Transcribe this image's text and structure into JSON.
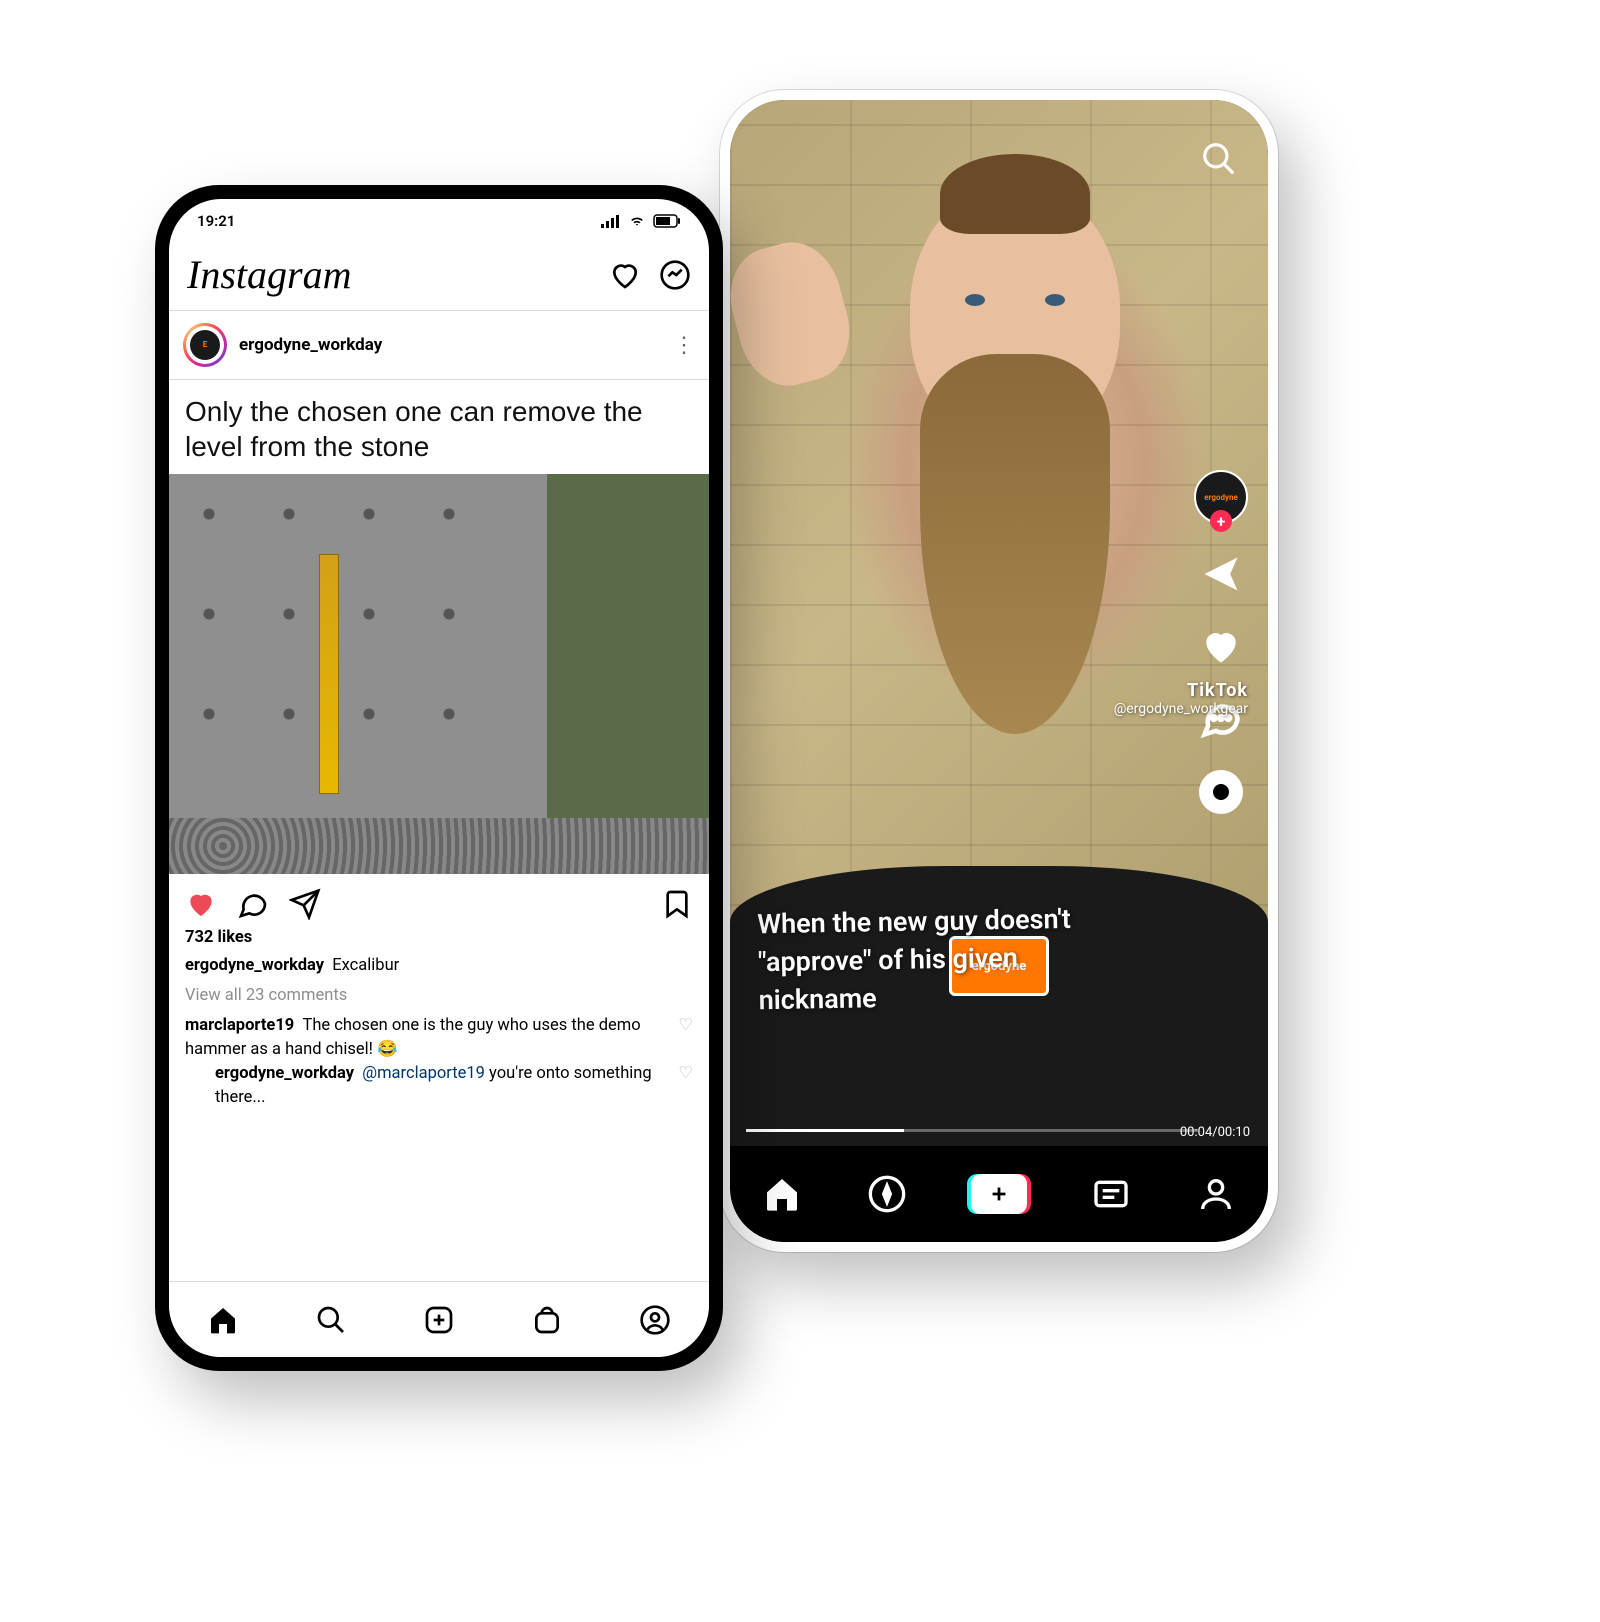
{
  "instagram": {
    "status_time": "19:21",
    "logo": "Instagram",
    "post": {
      "username": "ergodyne_workday",
      "meme_text": "Only the chosen one can remove the level from the stone",
      "likes": "732 likes",
      "caption_user": "ergodyne_workday",
      "caption_text": "Excalibur",
      "view_comments": "View all 23 comments",
      "comments": [
        {
          "user": "marclaporte19",
          "text": "The chosen one is the guy who uses the demo hammer as a hand chisel! 😂"
        }
      ],
      "reply": {
        "user": "ergodyne_workday",
        "mention": "@marclaporte19",
        "text": "you're onto something there..."
      }
    }
  },
  "tiktok": {
    "caption": "When the new guy doesn't \"approve\" of his given nickname",
    "watermark_brand": "TikTok",
    "watermark_handle": "@ergodyne_workgear",
    "time_current": "00:04",
    "time_sep": "/",
    "time_total": "00:10",
    "shirt_logo": "ergodyne",
    "profile_logo": "ergodyne"
  }
}
